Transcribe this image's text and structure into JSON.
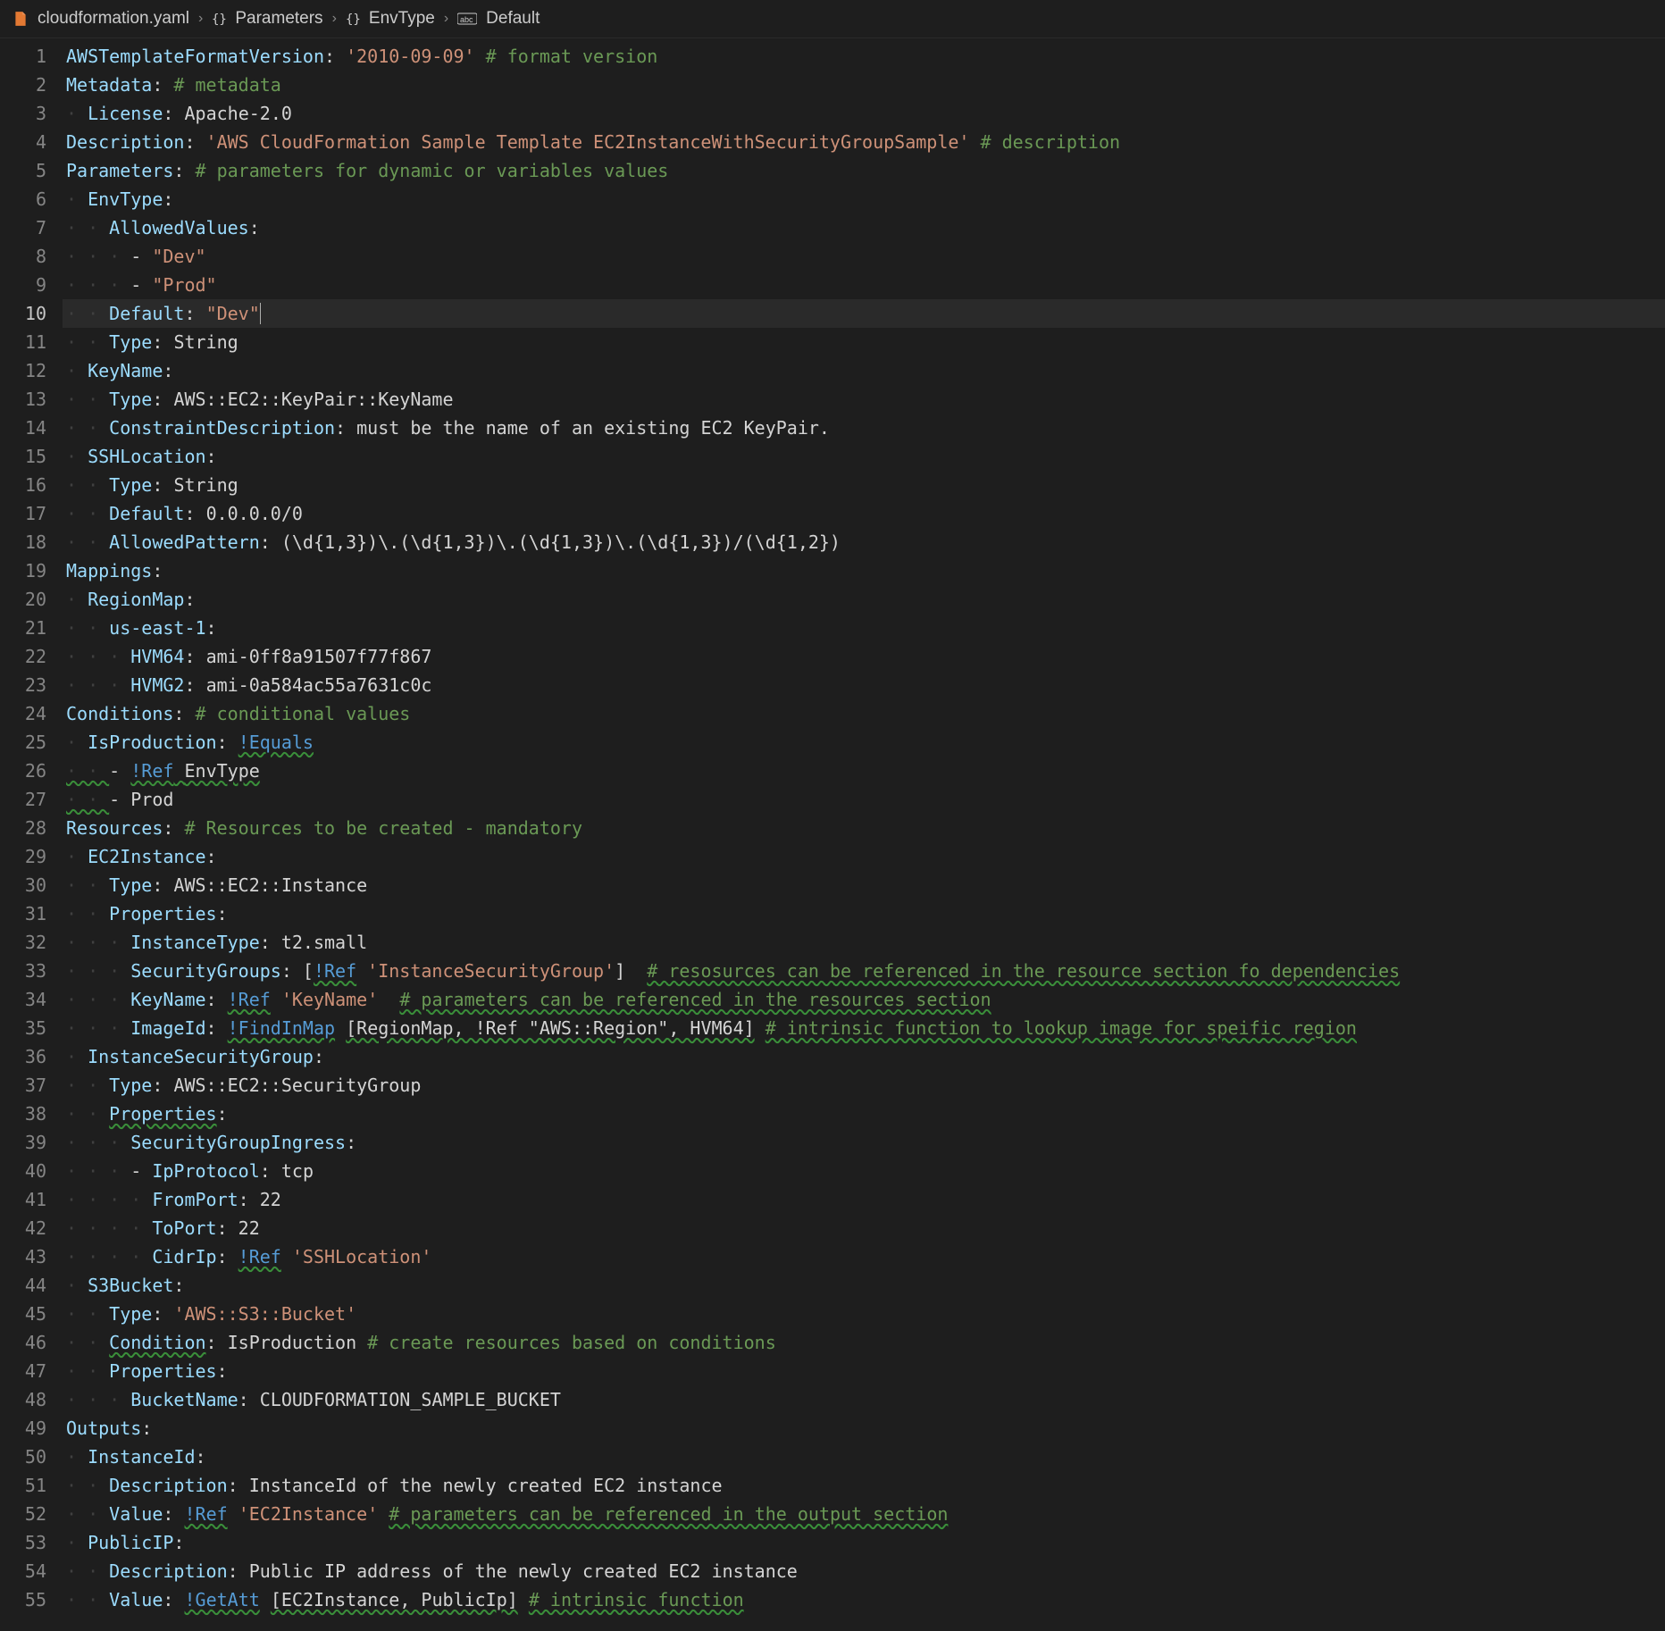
{
  "breadcrumb": {
    "file": "cloudformation.yaml",
    "path": [
      "Parameters",
      "EnvType",
      "Default"
    ],
    "path_icons": [
      "braces",
      "braces",
      "abc"
    ]
  },
  "active_line": 10,
  "lines": {
    "l1": {
      "k": "AWSTemplateFormatVersion",
      "v": "'2010-09-09'",
      "c": "# format version"
    },
    "l2": {
      "k": "Metadata",
      "c": "# metadata"
    },
    "l3": {
      "k": "License",
      "v": "Apache-2.0"
    },
    "l4": {
      "k": "Description",
      "v": "'AWS CloudFormation Sample Template EC2InstanceWithSecurityGroupSample'",
      "c": "# description"
    },
    "l5": {
      "k": "Parameters",
      "c": "# parameters for dynamic or variables values"
    },
    "l6": {
      "k": "EnvType"
    },
    "l7": {
      "k": "AllowedValues"
    },
    "l8": {
      "v": "\"Dev\""
    },
    "l9": {
      "v": "\"Prod\""
    },
    "l10": {
      "k": "Default",
      "v": "\"Dev\""
    },
    "l11": {
      "k": "Type",
      "v": "String"
    },
    "l12": {
      "k": "KeyName"
    },
    "l13": {
      "k": "Type",
      "v": "AWS::EC2::KeyPair::KeyName"
    },
    "l14": {
      "k": "ConstraintDescription",
      "v": "must be the name of an existing EC2 KeyPair."
    },
    "l15": {
      "k": "SSHLocation"
    },
    "l16": {
      "k": "Type",
      "v": "String"
    },
    "l17": {
      "k": "Default",
      "v": "0.0.0.0/0"
    },
    "l18": {
      "k": "AllowedPattern",
      "v": "(\\d{1,3})\\.(\\d{1,3})\\.(\\d{1,3})\\.(\\d{1,3})/(\\d{1,2})"
    },
    "l19": {
      "k": "Mappings"
    },
    "l20": {
      "k": "RegionMap"
    },
    "l21": {
      "k": "us-east-1"
    },
    "l22": {
      "k": "HVM64",
      "v": "ami-0ff8a91507f77f867"
    },
    "l23": {
      "k": "HVMG2",
      "v": "ami-0a584ac55a7631c0c"
    },
    "l24": {
      "k": "Conditions",
      "c": "# conditional values"
    },
    "l25": {
      "k": "IsProduction",
      "fn": "!Equals"
    },
    "l26": {
      "fn": "!Ref",
      "v": "EnvType"
    },
    "l27": {
      "v": "Prod"
    },
    "l28": {
      "k": "Resources",
      "c": "# Resources to be created - mandatory"
    },
    "l29": {
      "k": "EC2Instance"
    },
    "l30": {
      "k": "Type",
      "v": "AWS::EC2::Instance"
    },
    "l31": {
      "k": "Properties"
    },
    "l32": {
      "k": "InstanceType",
      "v": "t2.small"
    },
    "l33": {
      "k": "SecurityGroups",
      "fn": "!Ref",
      "v": "'InstanceSecurityGroup'",
      "c": "# resosurces can be referenced in the resource section fo dependencies"
    },
    "l34": {
      "k": "KeyName",
      "fn": "!Ref",
      "v": "'KeyName'",
      "c": "# parameters can be referenced in the resources section"
    },
    "l35": {
      "k": "ImageId",
      "fn": "!FindInMap",
      "args": "[RegionMap, !Ref \"AWS::Region\", HVM64]",
      "c": "# intrinsic function to lookup image for speific region"
    },
    "l36": {
      "k": "InstanceSecurityGroup"
    },
    "l37": {
      "k": "Type",
      "v": "AWS::EC2::SecurityGroup"
    },
    "l38": {
      "k": "Properties"
    },
    "l39": {
      "k": "SecurityGroupIngress"
    },
    "l40": {
      "k": "IpProtocol",
      "v": "tcp"
    },
    "l41": {
      "k": "FromPort",
      "v": "22"
    },
    "l42": {
      "k": "ToPort",
      "v": "22"
    },
    "l43": {
      "k": "CidrIp",
      "fn": "!Ref",
      "v": "'SSHLocation'"
    },
    "l44": {
      "k": "S3Bucket"
    },
    "l45": {
      "k": "Type",
      "v": "'AWS::S3::Bucket'"
    },
    "l46": {
      "k": "Condition",
      "v": "IsProduction",
      "c": "# create resources based on conditions"
    },
    "l47": {
      "k": "Properties"
    },
    "l48": {
      "k": "BucketName",
      "v": "CLOUDFORMATION_SAMPLE_BUCKET"
    },
    "l49": {
      "k": "Outputs"
    },
    "l50": {
      "k": "InstanceId"
    },
    "l51": {
      "k": "Description",
      "v": "InstanceId of the newly created EC2 instance"
    },
    "l52": {
      "k": "Value",
      "fn": "!Ref",
      "v": "'EC2Instance'",
      "c": "# parameters can be referenced in the output section"
    },
    "l53": {
      "k": "PublicIP"
    },
    "l54": {
      "k": "Description",
      "v": "Public IP address of the newly created EC2 instance"
    },
    "l55": {
      "k": "Value",
      "fn": "!GetAtt",
      "args": "[EC2Instance, PublicIp]",
      "c": "# intrinsic function"
    }
  }
}
